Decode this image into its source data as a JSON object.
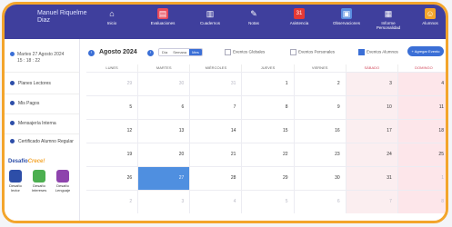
{
  "header": {
    "user_name": "Manuel Riquelme Diaz",
    "nav": [
      {
        "label": "Inicio",
        "icon": "home-icon"
      },
      {
        "label": "Evaluaciones",
        "icon": "clipboard-icon"
      },
      {
        "label": "Cuadernos",
        "icon": "notebook-icon"
      },
      {
        "label": "Notas",
        "icon": "grades-icon"
      },
      {
        "label": "Asistencia",
        "icon": "calendar-icon",
        "badge": "31"
      },
      {
        "label": "Observaciones",
        "icon": "observations-icon"
      },
      {
        "label": "Informe Personalidad",
        "icon": "report-icon"
      },
      {
        "label": "Alumnos",
        "icon": "students-icon"
      }
    ]
  },
  "sidebar": {
    "date_line1": "Martes 27 Agosto 2024",
    "date_line2": "15 : 18 : 22",
    "items": [
      {
        "label": "Planes Lectores"
      },
      {
        "label": "Mis Pagos"
      },
      {
        "label": "Mensajería Interna"
      },
      {
        "label": "Certificado Alumno Regular"
      }
    ],
    "desafio": {
      "title_main": "Desafío",
      "title_accent": "Crece!",
      "apps": [
        {
          "label": "Desafío lector",
          "color": "#2d4ea8"
        },
        {
          "label": "Desafío Intereses",
          "color": "#4caf50"
        },
        {
          "label": "Desafío Lenguaje",
          "color": "#8e44ad"
        }
      ]
    }
  },
  "calendar": {
    "month_title": "Agosto 2024",
    "views": [
      "Día",
      "Semana",
      "Mes"
    ],
    "active_view": "Mes",
    "filters": [
      {
        "label": "Eventos Globales",
        "checked": false
      },
      {
        "label": "Eventos Personales",
        "checked": false
      },
      {
        "label": "Eventos Alumnos",
        "checked": true
      }
    ],
    "add_button": "+ Agregar Evento",
    "weekdays": [
      "LUNES",
      "MARTES",
      "MIÉRCOLES",
      "JUEVES",
      "VIERNES",
      "SÁBADO",
      "DOMINGO"
    ],
    "weeks": [
      [
        {
          "d": "29",
          "o": true
        },
        {
          "d": "30",
          "o": true
        },
        {
          "d": "31",
          "o": true
        },
        {
          "d": "1"
        },
        {
          "d": "2"
        },
        {
          "d": "3"
        },
        {
          "d": "4"
        }
      ],
      [
        {
          "d": "5"
        },
        {
          "d": "6"
        },
        {
          "d": "7"
        },
        {
          "d": "8"
        },
        {
          "d": "9"
        },
        {
          "d": "10"
        },
        {
          "d": "11"
        }
      ],
      [
        {
          "d": "12"
        },
        {
          "d": "13"
        },
        {
          "d": "14"
        },
        {
          "d": "15"
        },
        {
          "d": "16"
        },
        {
          "d": "17"
        },
        {
          "d": "18"
        }
      ],
      [
        {
          "d": "19"
        },
        {
          "d": "20"
        },
        {
          "d": "21"
        },
        {
          "d": "22"
        },
        {
          "d": "23"
        },
        {
          "d": "24"
        },
        {
          "d": "25"
        }
      ],
      [
        {
          "d": "26"
        },
        {
          "d": "27",
          "sel": true
        },
        {
          "d": "28"
        },
        {
          "d": "29"
        },
        {
          "d": "30"
        },
        {
          "d": "31"
        },
        {
          "d": "1",
          "o": true
        }
      ],
      [
        {
          "d": "2",
          "o": true
        },
        {
          "d": "3",
          "o": true
        },
        {
          "d": "4",
          "o": true
        },
        {
          "d": "5",
          "o": true
        },
        {
          "d": "6",
          "o": true
        },
        {
          "d": "7",
          "o": true
        },
        {
          "d": "8",
          "o": true
        }
      ]
    ]
  },
  "colors": {
    "topbar": "#3f3f9d",
    "accent": "#3b6fd6",
    "frame": "#f3a52c",
    "weekend": "#fde6ea"
  }
}
